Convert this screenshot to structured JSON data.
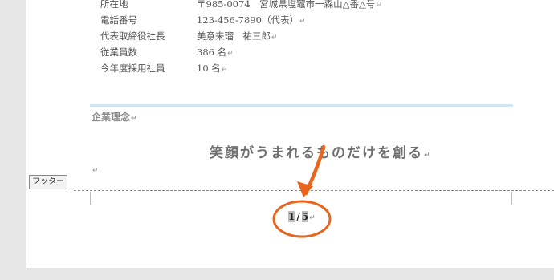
{
  "company_info": [
    {
      "label": "所在地",
      "value": "〒985-0074　宮城県塩竈市一森山△番△号"
    },
    {
      "label": "電話番号",
      "value": "123-456-7890（代表）"
    },
    {
      "label": "代表取締役社長",
      "value": "美意来瑠　祐三郎"
    },
    {
      "label": "従業員数",
      "value": "386 名"
    },
    {
      "label": "今年度採用社員",
      "value": "10 名"
    }
  ],
  "paragraph_mark": "↵",
  "section": {
    "title": "企業理念",
    "motto": "笑顔がうまれるものだけを創る"
  },
  "footer": {
    "tab_label": "フッター",
    "page_current": "1",
    "separator": "/",
    "page_total": "5"
  },
  "colors": {
    "annotation": "#e8651e",
    "rule": "#cfe6f0"
  }
}
